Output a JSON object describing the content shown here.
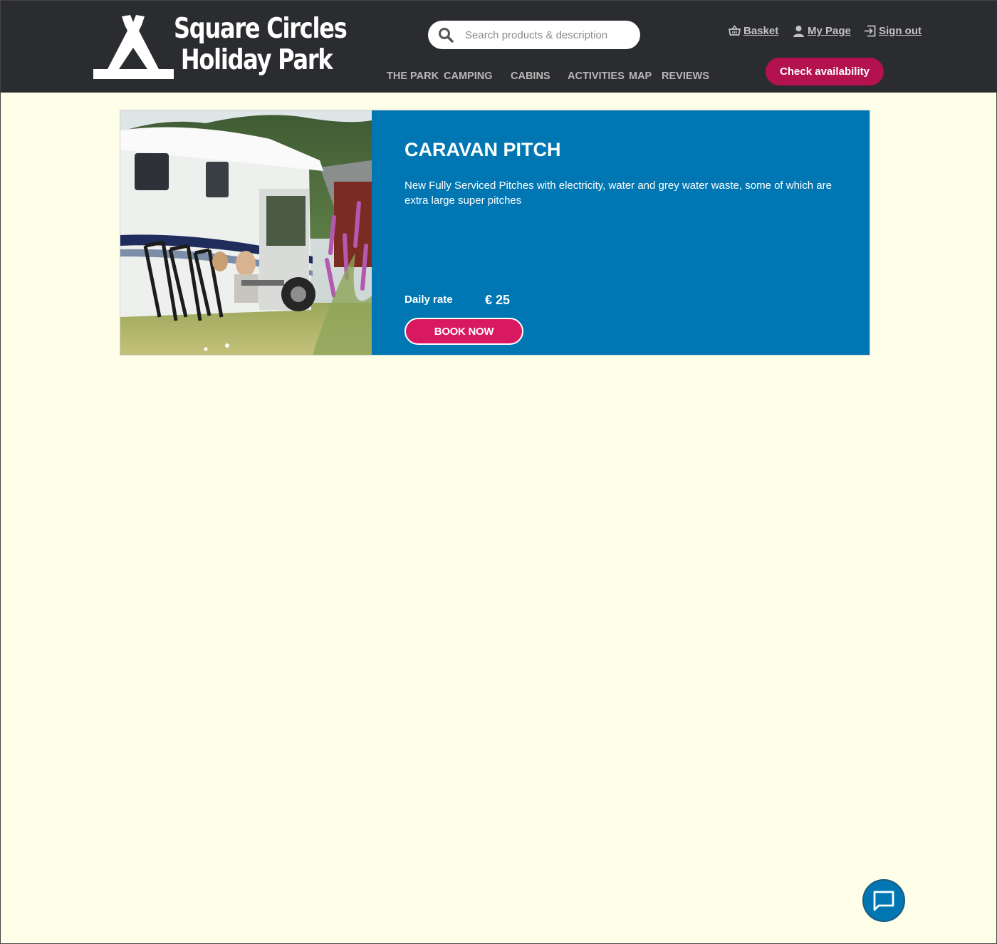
{
  "brand": {
    "line1": "Square Circles",
    "line2": "Holiday Park",
    "logo_icon": "tent-icon"
  },
  "search": {
    "placeholder": "Search products & description",
    "icon": "search-icon"
  },
  "nav": {
    "items": [
      "THE PARK",
      "CAMPING",
      "CABINS",
      "ACTIVITIES",
      "MAP",
      "REVIEWS"
    ]
  },
  "user_links": {
    "basket": "Basket",
    "my_page": "My Page",
    "sign_out": "Sign out"
  },
  "cta": {
    "check_availability": "Check availability"
  },
  "product": {
    "title": "CARAVAN PITCH",
    "description": "New Fully Serviced Pitches with electricity, water and grey water waste, some of which are extra large super pitches",
    "rate_label": "Daily rate",
    "rate_value": "€ 25",
    "book_label": "BOOK NOW",
    "image": "caravan-photo"
  },
  "chat": {
    "icon": "chat-icon"
  },
  "colors": {
    "header_bg": "#2b2c2f",
    "page_bg": "#fefee9",
    "card_blue": "#0077b3",
    "cta_crimson": "#b3124e",
    "book_pink": "#d9195f"
  }
}
